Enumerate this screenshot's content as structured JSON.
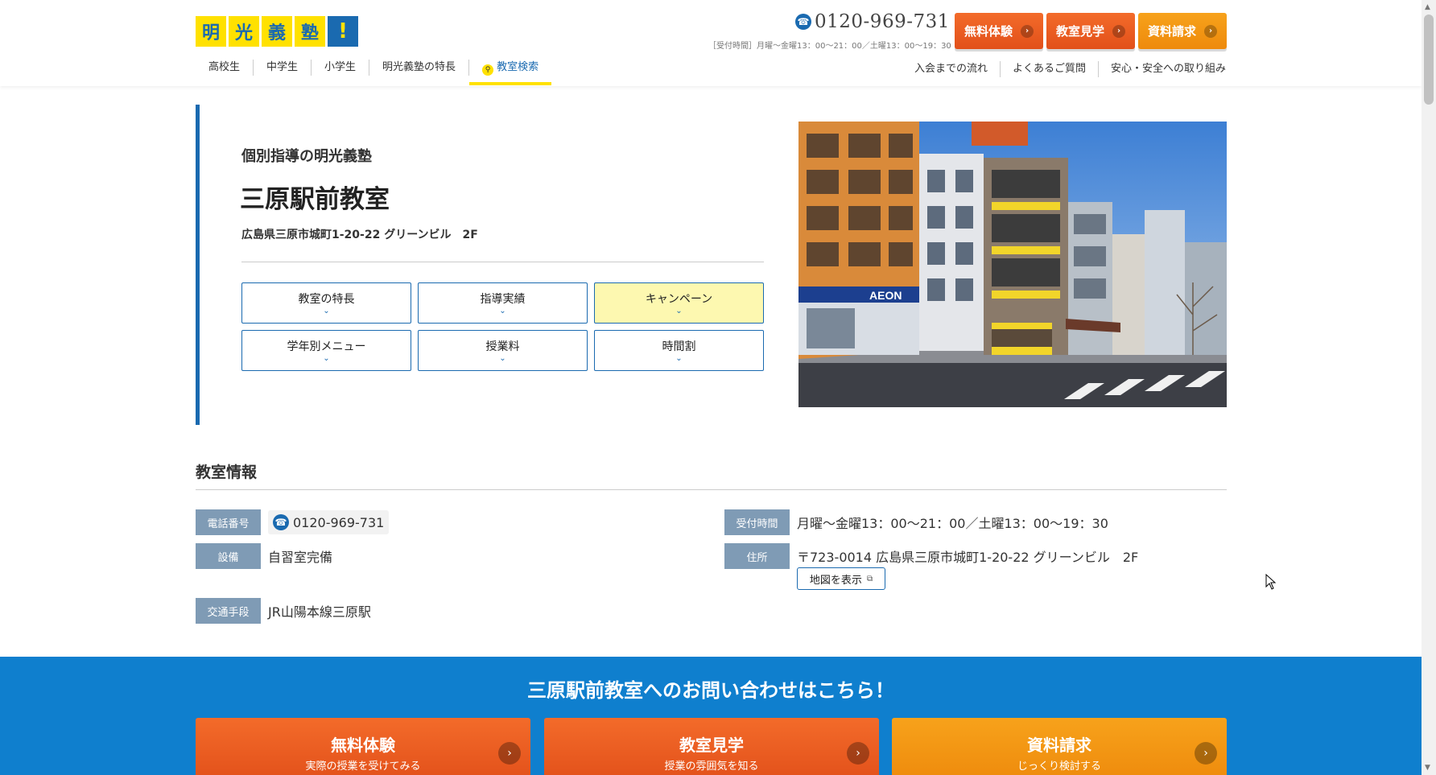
{
  "header": {
    "logo_chars": [
      "明",
      "光",
      "義",
      "塾",
      "!"
    ],
    "phone": "0120-969-731",
    "hours_note": "［受付時間］月曜～金曜13：00～21：00／土曜13：00～19：30",
    "buttons": [
      {
        "label": "無料体験",
        "color": "#e2501a"
      },
      {
        "label": "教室見学",
        "color": "#e2501a"
      },
      {
        "label": "資料請求",
        "color": "#ee8a0c"
      }
    ],
    "nav_left": [
      "高校生",
      "中学生",
      "小学生",
      "明光義塾の特長",
      "教室検索"
    ],
    "nav_right": [
      "入会までの流れ",
      "よくあるご質問",
      "安心・安全への取り組み"
    ]
  },
  "hero": {
    "subtitle": "個別指導の明光義塾",
    "title": "三原駅前教室",
    "address": "広島県三原市城町1-20-22 グリーンビル　2F",
    "anchors": [
      "教室の特長",
      "指導実績",
      "キャンペーン",
      "学年別メニュー",
      "授業料",
      "時間割"
    ],
    "photo_sign": "AEON"
  },
  "info": {
    "title": "教室情報",
    "phone_label": "電話番号",
    "phone_value": "0120-969-731",
    "hours_label": "受付時間",
    "hours_value": "月曜～金曜13：00～21：00／土曜13：00～19：30",
    "facility_label": "設備",
    "facility_value": "自習室完備",
    "address_label": "住所",
    "address_value": "〒723-0014 広島県三原市城町1-20-22 グリーンビル　2F",
    "map_button": "地図を表示",
    "transport_label": "交通手段",
    "transport_value": "JR山陽本線三原駅"
  },
  "cta": {
    "title": "三原駅前教室へのお問い合わせはこちら！",
    "buttons": [
      {
        "main": "無料体験",
        "sub": "実際の授業を受けてみる"
      },
      {
        "main": "教室見学",
        "sub": "授業の雰囲気を知る"
      },
      {
        "main": "資料請求",
        "sub": "じっくり検討する"
      }
    ]
  },
  "colors": {
    "brand_yellow": "#ffe100",
    "brand_blue": "#1a6ab0",
    "cta_blue": "#0f7fce",
    "orange": "#e2501a",
    "amber": "#ee8a0c",
    "tag_gray": "#7f9bb5"
  }
}
